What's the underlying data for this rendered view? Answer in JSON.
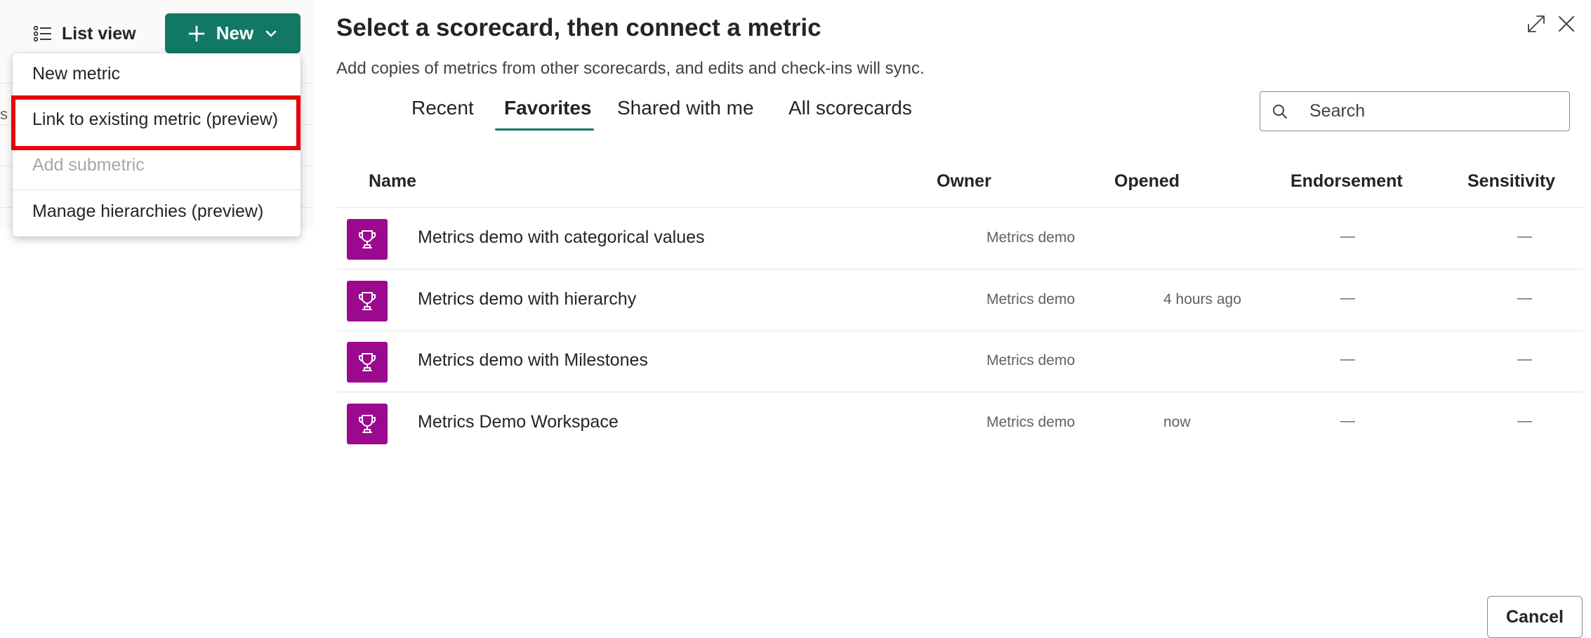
{
  "toolbar": {
    "list_view_label": "List view",
    "new_label": "New",
    "left_stub_char": "s"
  },
  "new_menu": {
    "items": [
      {
        "label": "New metric",
        "enabled": true
      },
      {
        "label": "Link to existing metric (preview)",
        "enabled": true,
        "highlighted": true
      },
      {
        "label": "Add submetric",
        "enabled": false
      },
      {
        "label": "Manage hierarchies (preview)",
        "enabled": true
      }
    ],
    "highlight_color": "#e8000b"
  },
  "dialog": {
    "title": "Select a scorecard, then connect a metric",
    "subtitle": "Add copies of metrics from other scorecards, and edits and check-ins will sync.",
    "tabs": [
      {
        "label": "Recent",
        "active": false
      },
      {
        "label": "Favorites",
        "active": true
      },
      {
        "label": "Shared with me",
        "active": false
      },
      {
        "label": "All scorecards",
        "active": false
      }
    ],
    "search": {
      "placeholder": "Search",
      "value": ""
    },
    "columns": {
      "name": "Name",
      "owner": "Owner",
      "opened": "Opened",
      "endorsement": "Endorsement",
      "sensitivity": "Sensitivity"
    },
    "rows": [
      {
        "name": "Metrics demo with categorical values",
        "owner": "Metrics demo",
        "opened": "",
        "endorsement": "—",
        "sensitivity": "—",
        "icon": "trophy-icon"
      },
      {
        "name": "Metrics demo with hierarchy",
        "owner": "Metrics demo",
        "opened": "4 hours ago",
        "endorsement": "—",
        "sensitivity": "—",
        "icon": "trophy-icon"
      },
      {
        "name": "Metrics demo with Milestones",
        "owner": "Metrics demo",
        "opened": "",
        "endorsement": "—",
        "sensitivity": "—",
        "icon": "trophy-icon"
      },
      {
        "name": "Metrics Demo Workspace",
        "owner": "Metrics demo",
        "opened": "now",
        "endorsement": "—",
        "sensitivity": "—",
        "icon": "trophy-icon"
      }
    ],
    "cancel_label": "Cancel"
  },
  "colors": {
    "accent": "#117865",
    "scorecard_icon_bg": "#9b098f",
    "highlight": "#e8000b"
  }
}
